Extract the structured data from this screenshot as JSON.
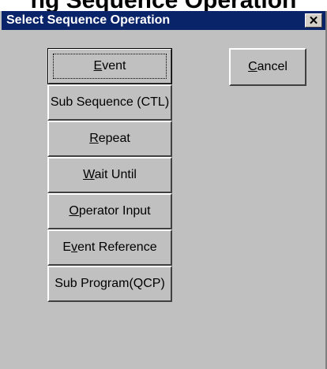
{
  "background_header": {
    "text": "ng Sequence Operation"
  },
  "window": {
    "title": "Select Sequence Operation",
    "close_glyph": "✕"
  },
  "buttons": [
    {
      "label": "Event",
      "mnemonic_index": 0
    },
    {
      "label": "Sub Sequence (CTL)",
      "mnemonic_index": -1
    },
    {
      "label": "Repeat",
      "mnemonic_index": 0
    },
    {
      "label": "Wait Until",
      "mnemonic_index": 0
    },
    {
      "label": "Operator Input",
      "mnemonic_index": 0
    },
    {
      "label": "Event Reference",
      "mnemonic_index": 1
    },
    {
      "label": "Sub Program(QCP)",
      "mnemonic_index": -1
    }
  ],
  "cancel": {
    "label": "Cancel",
    "mnemonic_index": 0
  },
  "colors": {
    "titlebar": "#0a246a",
    "face": "#c0c0c0"
  }
}
